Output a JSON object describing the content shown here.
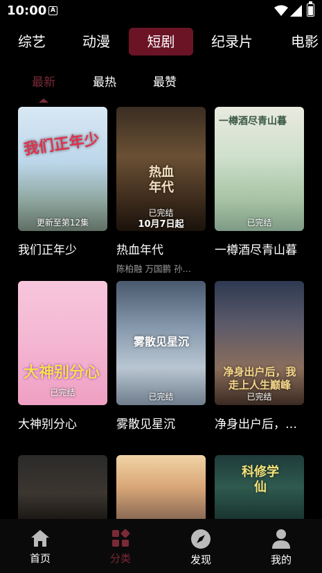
{
  "status_bar": {
    "time": "10:00",
    "notification_letter": "A"
  },
  "category_tabs": [
    {
      "label": "综艺",
      "active": false
    },
    {
      "label": "动漫",
      "active": false
    },
    {
      "label": "短剧",
      "active": true
    },
    {
      "label": "纪录片",
      "active": false
    },
    {
      "label": "电影",
      "active": false
    }
  ],
  "sub_tabs": [
    {
      "label": "最新",
      "active": true
    },
    {
      "label": "最热",
      "active": false
    },
    {
      "label": "最赞",
      "active": false
    }
  ],
  "cards": [
    {
      "title": "我们正年少",
      "caption": "更新至第12集",
      "subtitle": "",
      "art": "我们正年少"
    },
    {
      "title": "热血年代",
      "caption": "已完结",
      "subtitle": "陈柏融  万国鹏  孙…",
      "art": "热血年代",
      "banner": "10月7日起"
    },
    {
      "title": "一樽酒尽青山暮",
      "caption": "已完结",
      "subtitle": "",
      "art": "一樽酒尽青山暮"
    },
    {
      "title": "大神别分心",
      "caption": "已完结",
      "subtitle": "",
      "art": "大神别分心"
    },
    {
      "title": "雾散见星沉",
      "caption": "已完结",
      "subtitle": "",
      "art": "雾散见星沉"
    },
    {
      "title": "净身出户后，…",
      "caption": "已完结",
      "subtitle": "",
      "art": "净身出户后，我走上人生巅峰"
    },
    {
      "title": "",
      "caption": "",
      "subtitle": "",
      "art": ""
    },
    {
      "title": "",
      "caption": "",
      "subtitle": "",
      "art": ""
    },
    {
      "title": "",
      "caption": "",
      "subtitle": "",
      "art": "科修学仙"
    }
  ],
  "bottom_nav": [
    {
      "label": "首页",
      "icon": "home-icon",
      "active": false
    },
    {
      "label": "分类",
      "icon": "category-icon",
      "active": true
    },
    {
      "label": "发现",
      "icon": "compass-icon",
      "active": false
    },
    {
      "label": "我的",
      "icon": "user-icon",
      "active": false
    }
  ],
  "colors": {
    "accent": "#7a2a36",
    "active_tab_bg": "#6b1426",
    "background": "#000000"
  }
}
